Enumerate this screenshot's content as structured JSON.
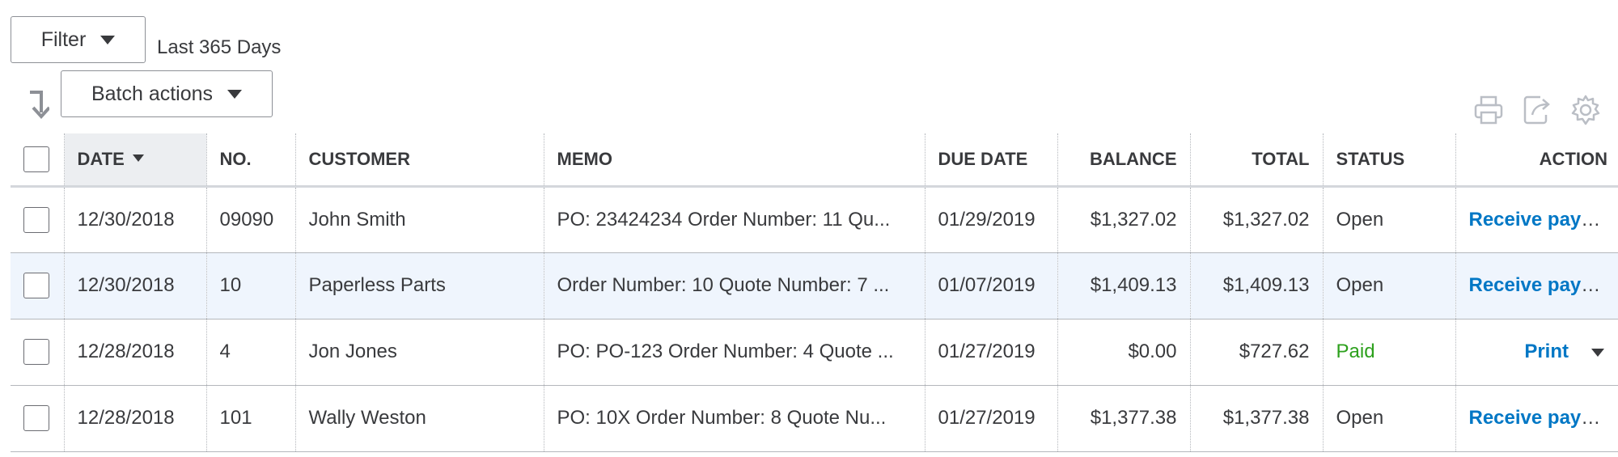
{
  "toolbar": {
    "filter_label": "Filter",
    "range_text": "Last 365 Days",
    "batch_label": "Batch actions",
    "icons": [
      "sort-arrow-icon",
      "print-icon",
      "export-icon",
      "settings-icon"
    ]
  },
  "table": {
    "columns": [
      "DATE",
      "NO.",
      "CUSTOMER",
      "MEMO",
      "DUE DATE",
      "BALANCE",
      "TOTAL",
      "STATUS",
      "ACTION"
    ],
    "rows": [
      {
        "date": "12/30/2018",
        "no": "09090",
        "customer": "John Smith",
        "memo": "PO: 23424234 Order Number: 11 Qu...",
        "due": "01/29/2019",
        "balance": "$1,327.02",
        "total": "$1,327.02",
        "status": "Open",
        "action": "Receive payment"
      },
      {
        "date": "12/30/2018",
        "no": "10",
        "customer": "Paperless Parts",
        "memo": "Order Number: 10 Quote Number: 7 ...",
        "due": "01/07/2019",
        "balance": "$1,409.13",
        "total": "$1,409.13",
        "status": "Open",
        "action": "Receive payment"
      },
      {
        "date": "12/28/2018",
        "no": "4",
        "customer": "Jon Jones",
        "memo": "PO: PO-123 Order Number: 4 Quote ...",
        "due": "01/27/2019",
        "balance": "$0.00",
        "total": "$727.62",
        "status": "Paid",
        "action": "Print"
      },
      {
        "date": "12/28/2018",
        "no": "101",
        "customer": "Wally Weston",
        "memo": "PO: 10X Order Number: 8 Quote Nu...",
        "due": "01/27/2019",
        "balance": "$1,377.38",
        "total": "$1,377.38",
        "status": "Open",
        "action": "Receive payment"
      }
    ]
  },
  "colors": {
    "link": "#0077c5",
    "paid": "#2ca01c",
    "highlight_row": "#eff5fd",
    "text": "#393a3d"
  }
}
